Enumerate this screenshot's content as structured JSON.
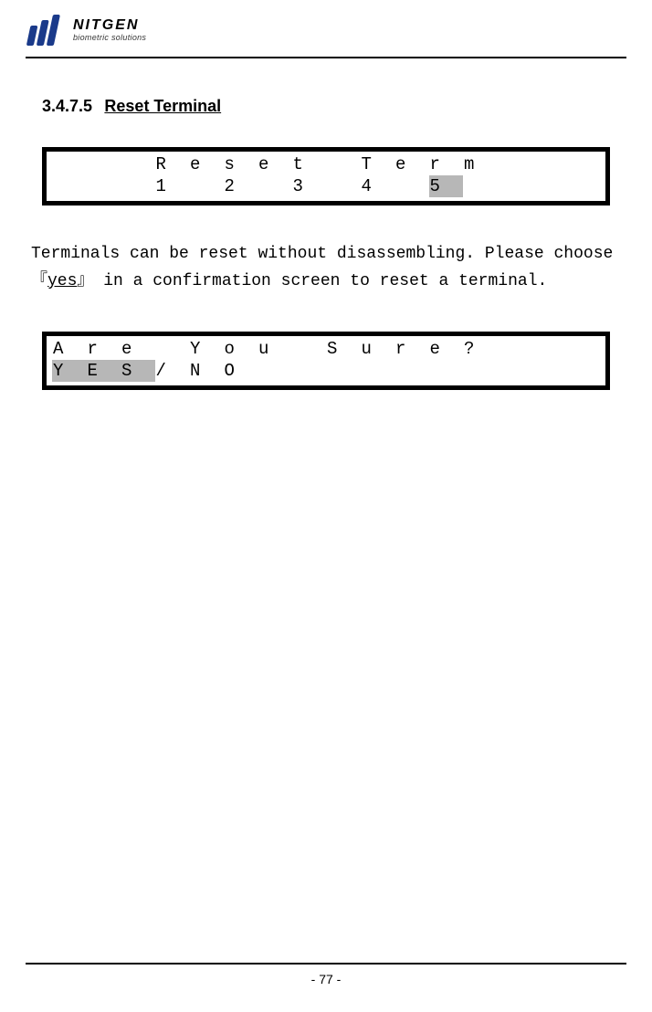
{
  "logo": {
    "main": "NITGEN",
    "sub": "biometric solutions"
  },
  "section": {
    "number": "3.4.7.5",
    "title": "Reset Terminal"
  },
  "lcd1": {
    "row1": [
      "",
      "",
      "",
      "R",
      "e",
      "s",
      "e",
      "t",
      "",
      "T",
      "e",
      "r",
      "m",
      "",
      "",
      ""
    ],
    "row2": [
      "",
      "",
      "",
      "1",
      "",
      "2",
      "",
      "3",
      "",
      "4",
      "",
      "5",
      "",
      "",
      "",
      ""
    ],
    "hl1": [],
    "hl2": [
      11
    ]
  },
  "body": {
    "line1_pre": "Terminals can be reset without disassembling. Please choose『",
    "yes": "yes",
    "line1_post": "』",
    "line2": "in a confirmation screen to reset a terminal."
  },
  "lcd2": {
    "row1": [
      "A",
      "r",
      "e",
      "",
      "Y",
      "o",
      "u",
      "",
      "S",
      "u",
      "r",
      "e",
      "?",
      "",
      "",
      ""
    ],
    "row2": [
      "Y",
      "E",
      "S",
      "/",
      "N",
      "O",
      "",
      "",
      "",
      "",
      "",
      "",
      "",
      "",
      "",
      ""
    ],
    "hl1": [],
    "hl2": [
      0,
      1,
      2
    ]
  },
  "footer": {
    "page": "- 77 -"
  }
}
